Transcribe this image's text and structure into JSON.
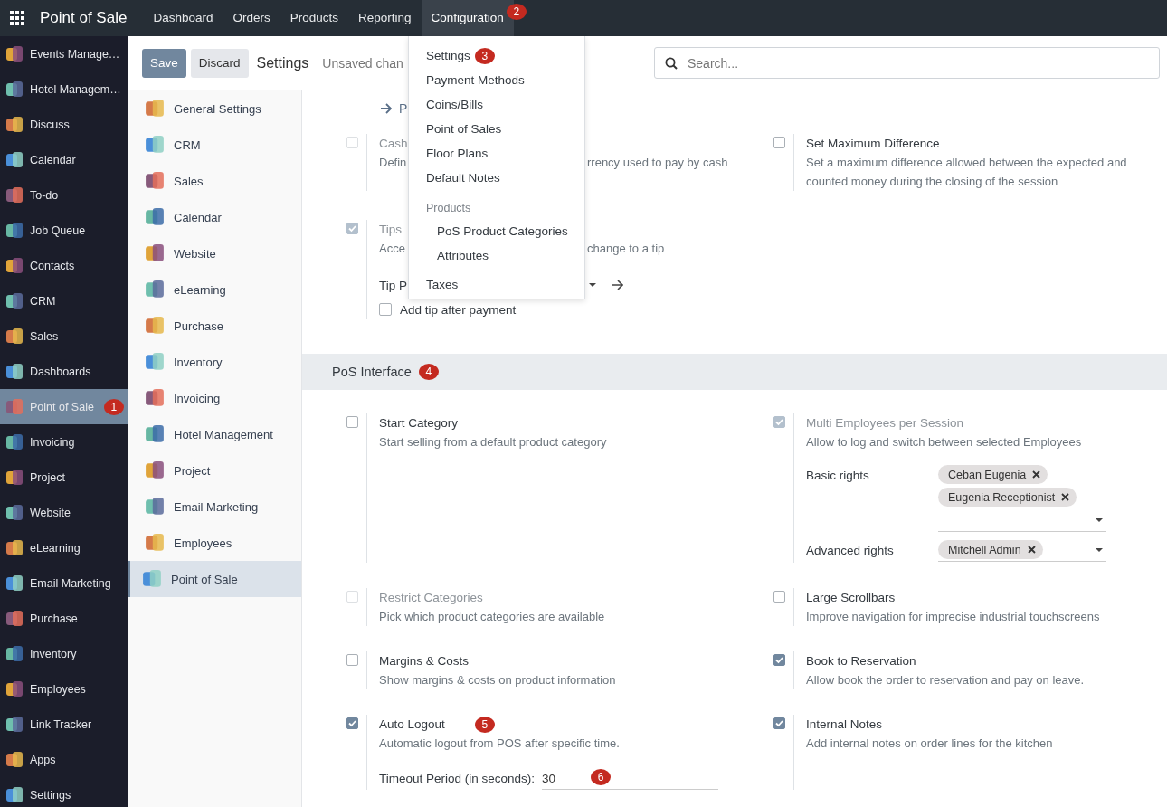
{
  "navbar": {
    "app_title": "Point of Sale",
    "menu": [
      {
        "label": "Dashboard",
        "selected": false
      },
      {
        "label": "Orders",
        "selected": false
      },
      {
        "label": "Products",
        "selected": false
      },
      {
        "label": "Reporting",
        "selected": false
      },
      {
        "label": "Configuration",
        "selected": true,
        "badge": "2"
      }
    ]
  },
  "apps_sidebar": {
    "items": [
      {
        "label": "Events Manage…",
        "selected": false
      },
      {
        "label": "Hotel Managem…",
        "selected": false
      },
      {
        "label": "Discuss",
        "selected": false
      },
      {
        "label": "Calendar",
        "selected": false
      },
      {
        "label": "To-do",
        "selected": false
      },
      {
        "label": "Job Queue",
        "selected": false
      },
      {
        "label": "Contacts",
        "selected": false
      },
      {
        "label": "CRM",
        "selected": false
      },
      {
        "label": "Sales",
        "selected": false
      },
      {
        "label": "Dashboards",
        "selected": false
      },
      {
        "label": "Point of Sale",
        "selected": true,
        "badge": "1"
      },
      {
        "label": "Invoicing",
        "selected": false
      },
      {
        "label": "Project",
        "selected": false
      },
      {
        "label": "Website",
        "selected": false
      },
      {
        "label": "eLearning",
        "selected": false
      },
      {
        "label": "Email Marketing",
        "selected": false
      },
      {
        "label": "Purchase",
        "selected": false
      },
      {
        "label": "Inventory",
        "selected": false
      },
      {
        "label": "Employees",
        "selected": false
      },
      {
        "label": "Link Tracker",
        "selected": false
      },
      {
        "label": "Apps",
        "selected": false
      },
      {
        "label": "Settings",
        "selected": false
      }
    ]
  },
  "control_panel": {
    "buttons": [
      {
        "label": "Save",
        "kind": "primary"
      },
      {
        "label": "Discard",
        "kind": "secondary"
      }
    ],
    "title": "Settings",
    "status": "Unsaved chan",
    "search": {
      "placeholder": "Search..."
    }
  },
  "config_menu": {
    "items": [
      {
        "kind": "item",
        "label": "Settings",
        "badge": "3"
      },
      {
        "kind": "item",
        "label": "Payment Methods"
      },
      {
        "kind": "item",
        "label": "Coins/Bills"
      },
      {
        "kind": "item",
        "label": "Point of Sales"
      },
      {
        "kind": "item",
        "label": "Floor Plans"
      },
      {
        "kind": "item",
        "label": "Default Notes"
      },
      {
        "kind": "header",
        "label": "Products"
      },
      {
        "kind": "subitem",
        "label": "PoS Product Categories"
      },
      {
        "kind": "subitem",
        "label": "Attributes"
      },
      {
        "kind": "item",
        "label": "Taxes"
      }
    ]
  },
  "settings_nav": {
    "items": [
      {
        "label": "General Settings",
        "selected": false
      },
      {
        "label": "CRM",
        "selected": false
      },
      {
        "label": "Sales",
        "selected": false
      },
      {
        "label": "Calendar",
        "selected": false
      },
      {
        "label": "Website",
        "selected": false
      },
      {
        "label": "eLearning",
        "selected": false
      },
      {
        "label": "Purchase",
        "selected": false
      },
      {
        "label": "Inventory",
        "selected": false
      },
      {
        "label": "Invoicing",
        "selected": false
      },
      {
        "label": "Hotel Management",
        "selected": false
      },
      {
        "label": "Project",
        "selected": false
      },
      {
        "label": "Email Marketing",
        "selected": false
      },
      {
        "label": "Employees",
        "selected": false
      },
      {
        "label": "Point of Sale",
        "selected": true
      }
    ]
  },
  "upper_section": {
    "link": "P",
    "settings": [
      {
        "title": "Cash",
        "description": "Defin",
        "description_tail": "rrency used to pay by cash",
        "checked": false,
        "disabled": true
      },
      {
        "title": "Set Maximum Difference",
        "description": "Set a maximum difference allowed between the expected and counted money during the closing of the session",
        "checked": false,
        "disabled": false
      },
      {
        "title": "Tips",
        "description": "Acce",
        "description_tail": "change to a tip",
        "checked": true,
        "disabled": true,
        "fields": [
          {
            "kind": "select_link",
            "label": "Tip P"
          },
          {
            "kind": "checkbox",
            "label": "Add tip after payment",
            "checked": false
          }
        ]
      }
    ]
  },
  "pos_interface": {
    "title": "PoS Interface",
    "badge": "4",
    "settings": [
      {
        "title": "Start Category",
        "description": "Start selling from a default product category",
        "checked": false,
        "disabled": false
      },
      {
        "title": "Multi Employees per Session",
        "description": "Allow to log and switch between selected Employees",
        "checked": true,
        "disabled": true,
        "fields": [
          {
            "kind": "tags",
            "label": "Basic rights",
            "tags": [
              "Ceban Eugenia",
              "Eugenia Receptionist"
            ]
          },
          {
            "kind": "tags",
            "label": "Advanced rights",
            "tags": [
              "Mitchell Admin"
            ]
          }
        ]
      },
      {
        "title": "Restrict Categories",
        "description": "Pick which product categories are available",
        "checked": false,
        "disabled": true
      },
      {
        "title": "Large Scrollbars",
        "description": "Improve navigation for imprecise industrial touchscreens",
        "checked": false,
        "disabled": false
      },
      {
        "title": "Margins & Costs",
        "description": "Show margins & costs on product information",
        "checked": false,
        "disabled": false
      },
      {
        "title": "Book to Reservation",
        "description": "Allow book the order to reservation and pay on leave.",
        "checked": true,
        "disabled": false
      },
      {
        "title": "Auto Logout",
        "description": "Automatic logout from POS after specific time.",
        "checked": true,
        "disabled": false,
        "badge": "5",
        "fields": [
          {
            "kind": "input",
            "label": "Timeout Period (in seconds):",
            "value": "30",
            "badge": "6"
          }
        ]
      },
      {
        "title": "Internal Notes",
        "description": "Add internal notes on order lines for the kitchen",
        "checked": true,
        "disabled": false
      }
    ]
  }
}
